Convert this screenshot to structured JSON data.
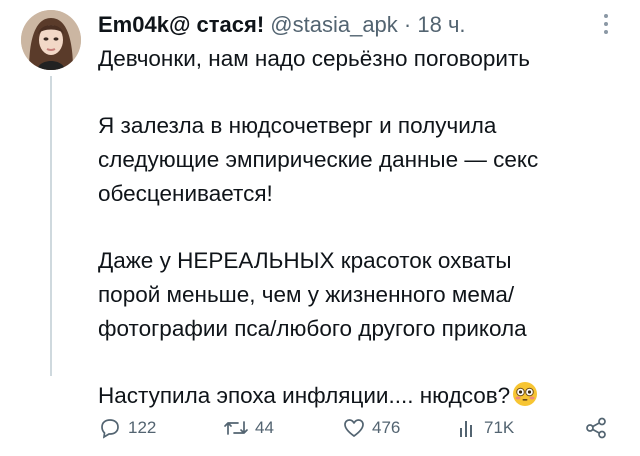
{
  "tweet": {
    "author_name": "Em04k@ стася!",
    "handle": "@stasia_apk",
    "separator": "·",
    "time": "18 ч.",
    "lines": [
      "Девчонки, нам надо серьёзно поговорить",
      "",
      "Я залезла в нюдсочетверг и получила",
      "следующие эмпирические данные — секс",
      "обесценивается!",
      "",
      "Даже у НЕРЕАЛЬНЫХ красоток охваты",
      "порой меньше, чем у жизненного мема/",
      "фотографии пса/любого другого прикола",
      "",
      "Наступила эпоха инфляции.... нюдсов?"
    ],
    "emoji": "flushed-face"
  },
  "actions": {
    "replies": "122",
    "retweets": "44",
    "likes": "476",
    "views": "71K"
  },
  "colors": {
    "text": "#0f1419",
    "secondary": "#536471",
    "thread_line": "#cfd9de",
    "emoji": "#f7c533"
  }
}
